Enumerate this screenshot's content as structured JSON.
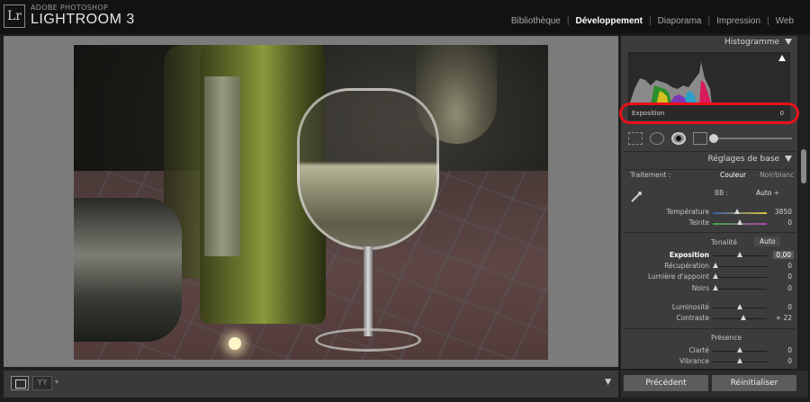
{
  "app": {
    "logo": "Lr",
    "vendor": "ADOBE PHOTOSHOP",
    "title": "LIGHTROOM 3"
  },
  "modules": [
    {
      "label": "Bibliothèque",
      "active": false
    },
    {
      "label": "Développement",
      "active": true
    },
    {
      "label": "Diaporama",
      "active": false
    },
    {
      "label": "Impression",
      "active": false
    },
    {
      "label": "Web",
      "active": false
    }
  ],
  "histogram": {
    "title": "Histogramme",
    "readout_label": "Exposition",
    "readout_value": "0",
    "highlight_color": "#e8101a"
  },
  "basic": {
    "title": "Réglages de base",
    "treatment_label": "Traitement :",
    "treatment_options": [
      "Couleur",
      "Noir/blanc"
    ],
    "wb_label": "BB :",
    "wb_value": "Auto ÷",
    "tone_label": "Tonalité",
    "auto_label": "Auto",
    "presence_label": "Présence",
    "sliders": [
      {
        "label": "Température",
        "value": "3850",
        "pos": 0.45
      },
      {
        "label": "Teinte",
        "value": "0",
        "pos": 0.5
      },
      {
        "label": "Exposition",
        "value": "0,00",
        "pos": 0.5
      },
      {
        "label": "Récupération",
        "value": "0",
        "pos": 0.0
      },
      {
        "label": "Lumière d'appoint",
        "value": "0",
        "pos": 0.0
      },
      {
        "label": "Noirs",
        "value": "0",
        "pos": 0.0
      },
      {
        "label": "Luminosité",
        "value": "0",
        "pos": 0.5
      },
      {
        "label": "Contraste",
        "value": "+ 22",
        "pos": 0.57
      },
      {
        "label": "Clarté",
        "value": "0",
        "pos": 0.5
      },
      {
        "label": "Vibrance",
        "value": "0",
        "pos": 0.5
      }
    ]
  },
  "toolbar": {
    "yy_label": "YY"
  },
  "buttons": {
    "previous": "Précédent",
    "reset": "Réinitialiser"
  }
}
